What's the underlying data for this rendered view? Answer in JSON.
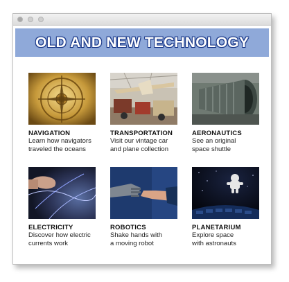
{
  "page": {
    "title": "OLD AND NEW TECHNOLOGY"
  },
  "colors": {
    "banner": "#8fa9d9",
    "title_outline": "#1d3b8a"
  },
  "exhibits": [
    {
      "title": "NAVIGATION",
      "line1": "Learn how navigators",
      "line2": "traveled the oceans",
      "image": "compass-photo"
    },
    {
      "title": "TRANSPORTATION",
      "line1": "Visit our vintage car",
      "line2": "and plane collection",
      "image": "vintage-plane-photo"
    },
    {
      "title": "AERONAUTICS",
      "line1": "See an original",
      "line2": "space shuttle",
      "image": "rocket-engine-photo"
    },
    {
      "title": "ELECTRICITY",
      "line1": "Discover how electric",
      "line2": "currents work",
      "image": "plasma-ball-photo"
    },
    {
      "title": "ROBOTICS",
      "line1": "Shake hands with",
      "line2": "a moving robot",
      "image": "robot-handshake-photo"
    },
    {
      "title": "PLANETARIUM",
      "line1": "Explore space",
      "line2": "with astronauts",
      "image": "planetarium-dome-photo"
    }
  ]
}
